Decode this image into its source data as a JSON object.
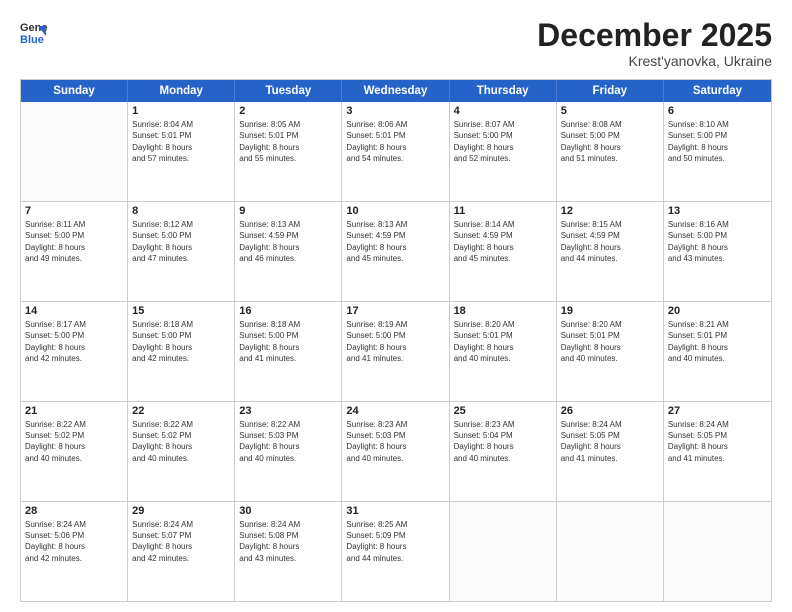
{
  "header": {
    "logo_line1": "General",
    "logo_line2": "Blue",
    "month": "December 2025",
    "location": "Krest'yanovka, Ukraine"
  },
  "weekdays": [
    "Sunday",
    "Monday",
    "Tuesday",
    "Wednesday",
    "Thursday",
    "Friday",
    "Saturday"
  ],
  "rows": [
    [
      {
        "day": "",
        "lines": []
      },
      {
        "day": "1",
        "lines": [
          "Sunrise: 8:04 AM",
          "Sunset: 5:01 PM",
          "Daylight: 8 hours",
          "and 57 minutes."
        ]
      },
      {
        "day": "2",
        "lines": [
          "Sunrise: 8:05 AM",
          "Sunset: 5:01 PM",
          "Daylight: 8 hours",
          "and 55 minutes."
        ]
      },
      {
        "day": "3",
        "lines": [
          "Sunrise: 8:06 AM",
          "Sunset: 5:01 PM",
          "Daylight: 8 hours",
          "and 54 minutes."
        ]
      },
      {
        "day": "4",
        "lines": [
          "Sunrise: 8:07 AM",
          "Sunset: 5:00 PM",
          "Daylight: 8 hours",
          "and 52 minutes."
        ]
      },
      {
        "day": "5",
        "lines": [
          "Sunrise: 8:08 AM",
          "Sunset: 5:00 PM",
          "Daylight: 8 hours",
          "and 51 minutes."
        ]
      },
      {
        "day": "6",
        "lines": [
          "Sunrise: 8:10 AM",
          "Sunset: 5:00 PM",
          "Daylight: 8 hours",
          "and 50 minutes."
        ]
      }
    ],
    [
      {
        "day": "7",
        "lines": [
          "Sunrise: 8:11 AM",
          "Sunset: 5:00 PM",
          "Daylight: 8 hours",
          "and 49 minutes."
        ]
      },
      {
        "day": "8",
        "lines": [
          "Sunrise: 8:12 AM",
          "Sunset: 5:00 PM",
          "Daylight: 8 hours",
          "and 47 minutes."
        ]
      },
      {
        "day": "9",
        "lines": [
          "Sunrise: 8:13 AM",
          "Sunset: 4:59 PM",
          "Daylight: 8 hours",
          "and 46 minutes."
        ]
      },
      {
        "day": "10",
        "lines": [
          "Sunrise: 8:13 AM",
          "Sunset: 4:59 PM",
          "Daylight: 8 hours",
          "and 45 minutes."
        ]
      },
      {
        "day": "11",
        "lines": [
          "Sunrise: 8:14 AM",
          "Sunset: 4:59 PM",
          "Daylight: 8 hours",
          "and 45 minutes."
        ]
      },
      {
        "day": "12",
        "lines": [
          "Sunrise: 8:15 AM",
          "Sunset: 4:59 PM",
          "Daylight: 8 hours",
          "and 44 minutes."
        ]
      },
      {
        "day": "13",
        "lines": [
          "Sunrise: 8:16 AM",
          "Sunset: 5:00 PM",
          "Daylight: 8 hours",
          "and 43 minutes."
        ]
      }
    ],
    [
      {
        "day": "14",
        "lines": [
          "Sunrise: 8:17 AM",
          "Sunset: 5:00 PM",
          "Daylight: 8 hours",
          "and 42 minutes."
        ]
      },
      {
        "day": "15",
        "lines": [
          "Sunrise: 8:18 AM",
          "Sunset: 5:00 PM",
          "Daylight: 8 hours",
          "and 42 minutes."
        ]
      },
      {
        "day": "16",
        "lines": [
          "Sunrise: 8:18 AM",
          "Sunset: 5:00 PM",
          "Daylight: 8 hours",
          "and 41 minutes."
        ]
      },
      {
        "day": "17",
        "lines": [
          "Sunrise: 8:19 AM",
          "Sunset: 5:00 PM",
          "Daylight: 8 hours",
          "and 41 minutes."
        ]
      },
      {
        "day": "18",
        "lines": [
          "Sunrise: 8:20 AM",
          "Sunset: 5:01 PM",
          "Daylight: 8 hours",
          "and 40 minutes."
        ]
      },
      {
        "day": "19",
        "lines": [
          "Sunrise: 8:20 AM",
          "Sunset: 5:01 PM",
          "Daylight: 8 hours",
          "and 40 minutes."
        ]
      },
      {
        "day": "20",
        "lines": [
          "Sunrise: 8:21 AM",
          "Sunset: 5:01 PM",
          "Daylight: 8 hours",
          "and 40 minutes."
        ]
      }
    ],
    [
      {
        "day": "21",
        "lines": [
          "Sunrise: 8:22 AM",
          "Sunset: 5:02 PM",
          "Daylight: 8 hours",
          "and 40 minutes."
        ]
      },
      {
        "day": "22",
        "lines": [
          "Sunrise: 8:22 AM",
          "Sunset: 5:02 PM",
          "Daylight: 8 hours",
          "and 40 minutes."
        ]
      },
      {
        "day": "23",
        "lines": [
          "Sunrise: 8:22 AM",
          "Sunset: 5:03 PM",
          "Daylight: 8 hours",
          "and 40 minutes."
        ]
      },
      {
        "day": "24",
        "lines": [
          "Sunrise: 8:23 AM",
          "Sunset: 5:03 PM",
          "Daylight: 8 hours",
          "and 40 minutes."
        ]
      },
      {
        "day": "25",
        "lines": [
          "Sunrise: 8:23 AM",
          "Sunset: 5:04 PM",
          "Daylight: 8 hours",
          "and 40 minutes."
        ]
      },
      {
        "day": "26",
        "lines": [
          "Sunrise: 8:24 AM",
          "Sunset: 5:05 PM",
          "Daylight: 8 hours",
          "and 41 minutes."
        ]
      },
      {
        "day": "27",
        "lines": [
          "Sunrise: 8:24 AM",
          "Sunset: 5:05 PM",
          "Daylight: 8 hours",
          "and 41 minutes."
        ]
      }
    ],
    [
      {
        "day": "28",
        "lines": [
          "Sunrise: 8:24 AM",
          "Sunset: 5:06 PM",
          "Daylight: 8 hours",
          "and 42 minutes."
        ]
      },
      {
        "day": "29",
        "lines": [
          "Sunrise: 8:24 AM",
          "Sunset: 5:07 PM",
          "Daylight: 8 hours",
          "and 42 minutes."
        ]
      },
      {
        "day": "30",
        "lines": [
          "Sunrise: 8:24 AM",
          "Sunset: 5:08 PM",
          "Daylight: 8 hours",
          "and 43 minutes."
        ]
      },
      {
        "day": "31",
        "lines": [
          "Sunrise: 8:25 AM",
          "Sunset: 5:09 PM",
          "Daylight: 8 hours",
          "and 44 minutes."
        ]
      },
      {
        "day": "",
        "lines": []
      },
      {
        "day": "",
        "lines": []
      },
      {
        "day": "",
        "lines": []
      }
    ]
  ]
}
